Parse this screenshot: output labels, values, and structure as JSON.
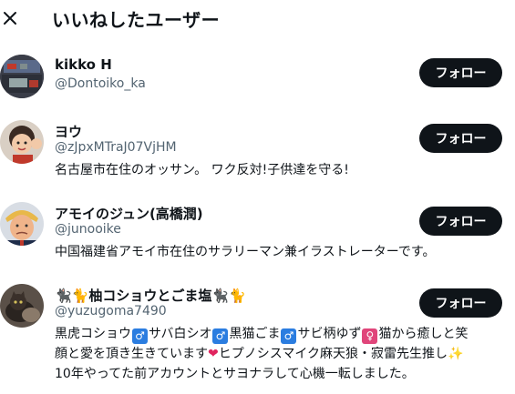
{
  "header": {
    "title": "いいねしたユーザー",
    "close_icon": "close-icon"
  },
  "colors": {
    "follow_bg": "#0f1419",
    "handle_text": "#536471"
  },
  "users": [
    {
      "name": "kikko H",
      "handle": "@Dontoiko_ka",
      "follow_label": "フォロー"
    },
    {
      "name": "ヨウ",
      "handle": "@zJpxMTraJ07VjHM",
      "bio": "名古屋市在住のオッサン。 ワク反対!子供達を守る!",
      "follow_label": "フォロー"
    },
    {
      "name": "アモイのジュン(高橋潤)",
      "handle": "@junooike",
      "bio": "中国福建省アモイ市在住のサラリーマン兼イラストレーターです。",
      "follow_label": "フォロー"
    },
    {
      "name_text": "柚コショウとごま塩",
      "handle": "@yuzugoma7490",
      "bio_parts": {
        "p1": "黒虎コショウ",
        "p2": "サバ白シオ",
        "p3": "黒猫ごま",
        "p4": "サビ柄ゆず",
        "p5": "猫から癒しと笑",
        "line2a": "顔と愛を頂き生きています",
        "line2b": "ヒプノシスマイク麻天狼・寂雷先生推し",
        "line3": "10年やってた前アカウントとサヨナラして心機一転しました。"
      },
      "follow_label": "フォロー"
    }
  ]
}
